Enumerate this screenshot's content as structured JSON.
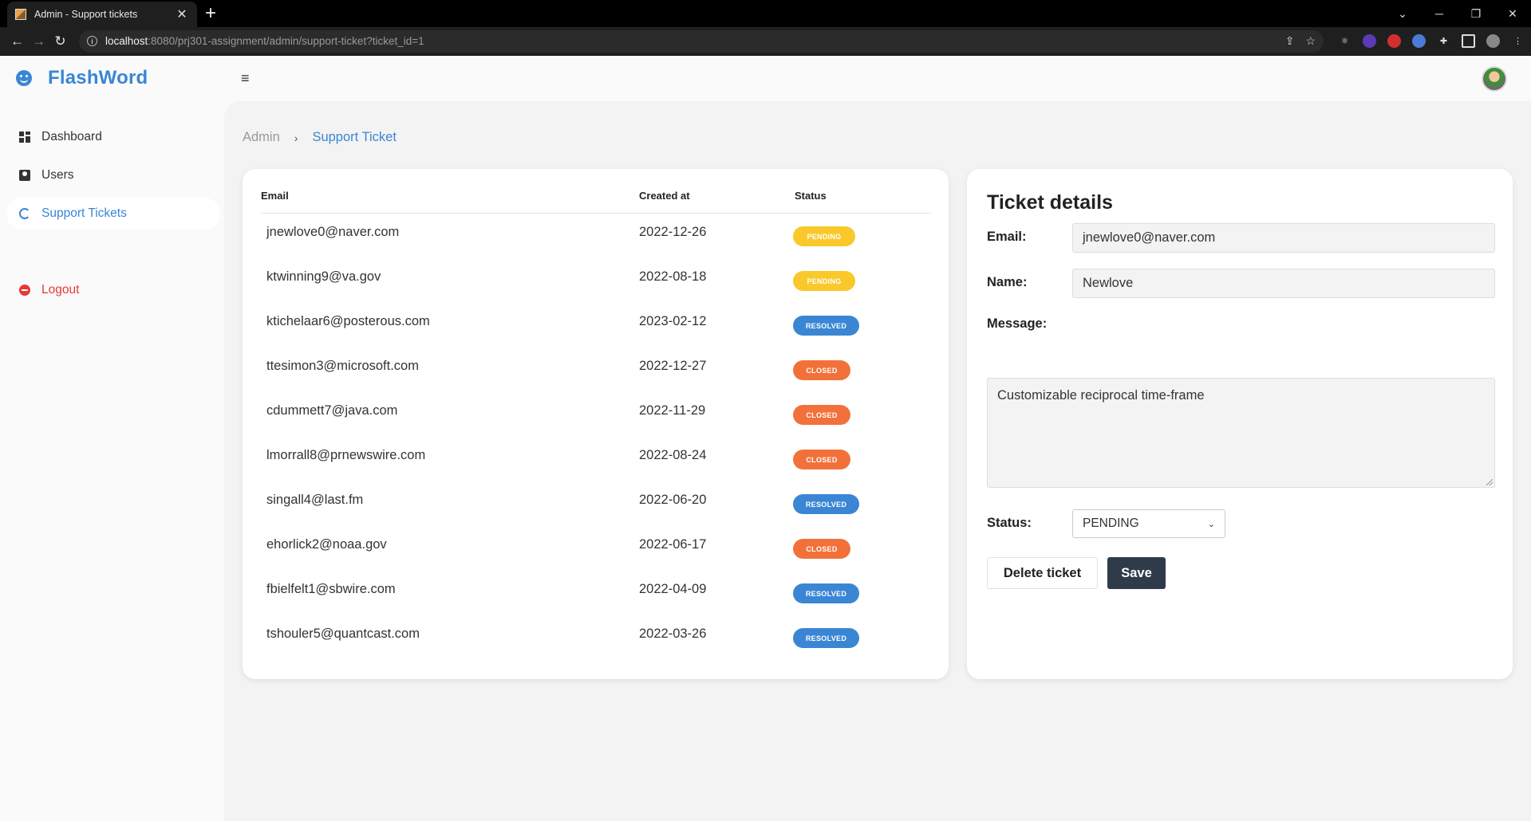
{
  "browser": {
    "tab_title": "Admin - Support tickets",
    "url_host": "localhost",
    "url_rest": ":8080/prj301-assignment/admin/support-ticket?ticket_id=1"
  },
  "app": {
    "brand": "FlashWord"
  },
  "sidebar": {
    "items": [
      {
        "label": "Dashboard",
        "icon": "dashboard-icon"
      },
      {
        "label": "Users",
        "icon": "users-icon"
      },
      {
        "label": "Support Tickets",
        "icon": "support-icon"
      },
      {
        "label": "Logout",
        "icon": "logout-icon"
      }
    ]
  },
  "breadcrumb": {
    "root": "Admin",
    "current": "Support Ticket"
  },
  "table": {
    "headers": {
      "email": "Email",
      "created": "Created at",
      "status": "Status"
    },
    "rows": [
      {
        "email": "jnewlove0@naver.com",
        "created": "2022-12-26",
        "status": "PENDING"
      },
      {
        "email": "ktwinning9@va.gov",
        "created": "2022-08-18",
        "status": "PENDING"
      },
      {
        "email": "ktichelaar6@posterous.com",
        "created": "2023-02-12",
        "status": "RESOLVED"
      },
      {
        "email": "ttesimon3@microsoft.com",
        "created": "2022-12-27",
        "status": "CLOSED"
      },
      {
        "email": "cdummett7@java.com",
        "created": "2022-11-29",
        "status": "CLOSED"
      },
      {
        "email": "lmorrall8@prnewswire.com",
        "created": "2022-08-24",
        "status": "CLOSED"
      },
      {
        "email": "singall4@last.fm",
        "created": "2022-06-20",
        "status": "RESOLVED"
      },
      {
        "email": "ehorlick2@noaa.gov",
        "created": "2022-06-17",
        "status": "CLOSED"
      },
      {
        "email": "fbielfelt1@sbwire.com",
        "created": "2022-04-09",
        "status": "RESOLVED"
      },
      {
        "email": "tshouler5@quantcast.com",
        "created": "2022-03-26",
        "status": "RESOLVED"
      }
    ]
  },
  "details": {
    "title": "Ticket details",
    "email_label": "Email:",
    "email_value": "jnewlove0@naver.com",
    "name_label": "Name:",
    "name_value": "Newlove",
    "message_label": "Message:",
    "message_value": "Customizable reciprocal time-frame",
    "status_label": "Status:",
    "status_value": "PENDING",
    "delete_label": "Delete ticket",
    "save_label": "Save"
  },
  "colors": {
    "accent": "#3a86d4",
    "pending": "#f9c82a",
    "resolved": "#3a86d4",
    "closed": "#f2713a",
    "logout": "#e53935",
    "save_button": "#2f3a4a"
  }
}
